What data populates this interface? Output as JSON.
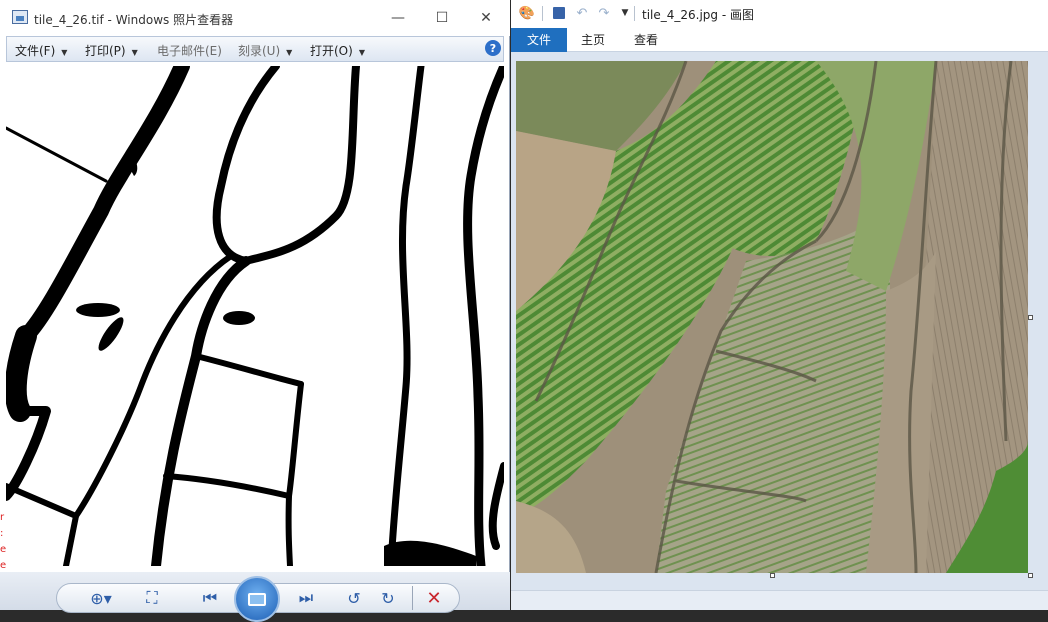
{
  "viewer": {
    "title": "tile_4_26.tif - Windows 照片查看器",
    "menu": {
      "file": "文件(F)",
      "print": "打印(P)",
      "email": "电子邮件(E)",
      "burn": "刻录(U)",
      "open": "打开(O)"
    },
    "help_glyph": "?",
    "window_controls": {
      "minimize": "—",
      "maximize": "☐",
      "close": "✕"
    },
    "toolbar_icons": [
      "zoom-icon",
      "actual-size-icon",
      "previous-icon",
      "slideshow-icon",
      "next-icon",
      "rotate-counterclockwise-icon",
      "rotate-clockwise-icon",
      "delete-icon"
    ],
    "edge_text": "r\n:\ne\ne"
  },
  "paint": {
    "title": "tile_4_26.jpg - 画图",
    "tabs": {
      "file": "文件",
      "home": "主页",
      "view": "查看"
    },
    "quick_access_icons": [
      "paint-app-icon",
      "save-icon",
      "undo-icon",
      "redo-icon",
      "customize-dropdown-icon"
    ]
  },
  "colors": {
    "accent_blue": "#1f6fbf",
    "delete_red": "#c8262d",
    "field_green": "#5c8a3a",
    "soil_brown": "#9c8e78"
  }
}
